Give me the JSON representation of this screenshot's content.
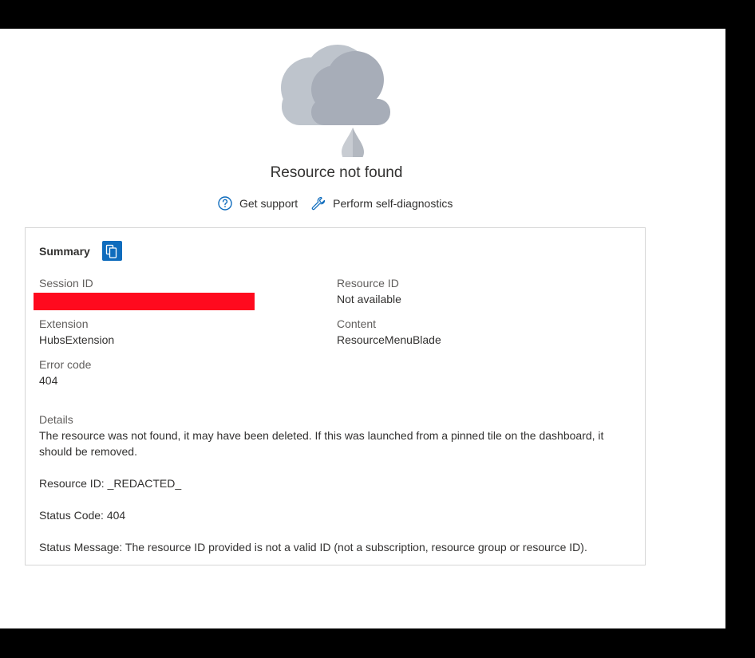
{
  "error": {
    "title": "Resource not found"
  },
  "actions": {
    "get_support": "Get support",
    "self_diagnostics": "Perform self-diagnostics"
  },
  "summary": {
    "title": "Summary",
    "session_id_label": "Session ID",
    "resource_id_label": "Resource ID",
    "resource_id_value": "Not available",
    "extension_label": "Extension",
    "extension_value": "HubsExtension",
    "content_label": "Content",
    "content_value": "ResourceMenuBlade",
    "error_code_label": "Error code",
    "error_code_value": "404",
    "details_label": "Details",
    "details_lines": [
      "The resource was not found, it may have been deleted. If this was launched from a pinned tile on the dashboard, it should be removed.",
      "Resource ID: _REDACTED_",
      "Status Code: 404",
      "Status Message: The resource ID provided is not a valid ID (not a subscription, resource group or resource ID)."
    ]
  },
  "colors": {
    "accent": "#0f6cbd",
    "redaction": "#ff0a1e",
    "cloud_light": "#bec4cc",
    "cloud_dark": "#a7adb8"
  }
}
